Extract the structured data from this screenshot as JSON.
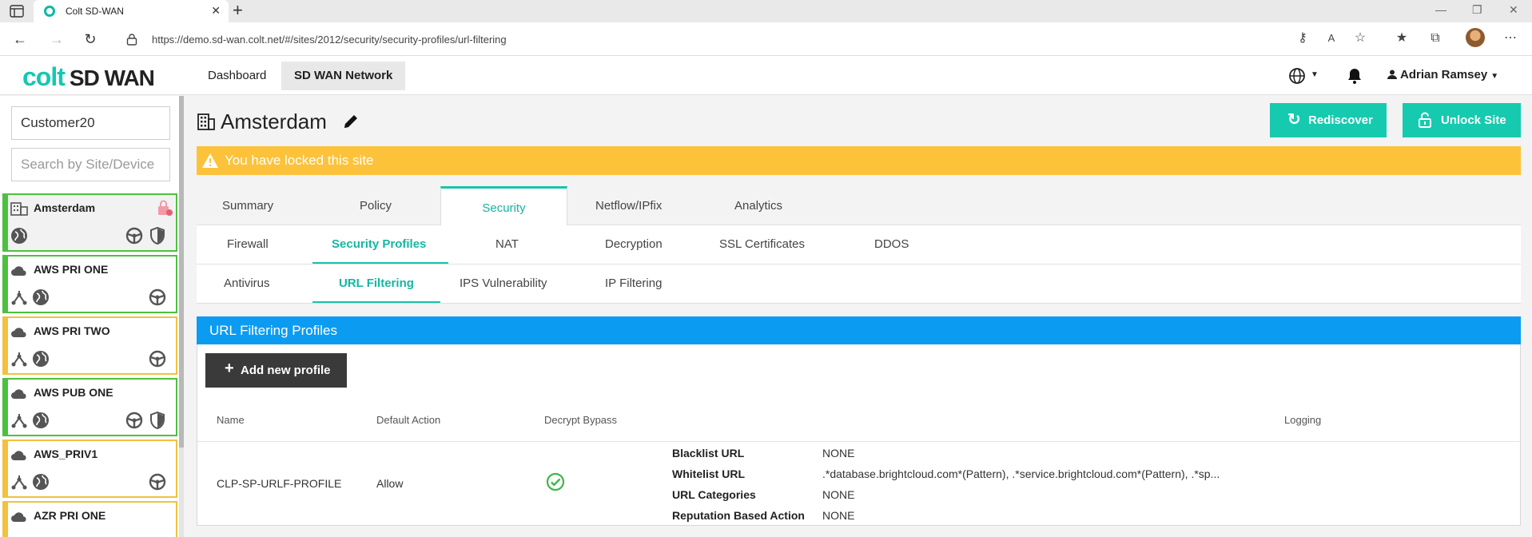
{
  "browser": {
    "tab_title": "Colt SD-WAN",
    "url": "https://demo.sd-wan.colt.net/#/sites/2012/security/security-profiles/url-filtering"
  },
  "app": {
    "logo_colt": "colt",
    "logo_sdwan": "SD WAN",
    "nav": [
      {
        "label": "Dashboard"
      },
      {
        "label": "SD WAN Network"
      }
    ],
    "user_name": "Adrian Ramsey"
  },
  "sidebar": {
    "customer": "Customer20",
    "search_placeholder": "Search by Site/Device",
    "sites": [
      {
        "name": "Amsterdam",
        "status": "green",
        "kind": "building"
      },
      {
        "name": "AWS PRI ONE",
        "status": "green",
        "kind": "cloud"
      },
      {
        "name": "AWS PRI TWO",
        "status": "yellow",
        "kind": "cloud"
      },
      {
        "name": "AWS PUB ONE",
        "status": "green",
        "kind": "cloud"
      },
      {
        "name": "AWS_PRIV1",
        "status": "yellow",
        "kind": "cloud"
      },
      {
        "name": "AZR PRI ONE",
        "status": "yellow",
        "kind": "cloud"
      }
    ]
  },
  "page": {
    "title": "Amsterdam",
    "rediscover_label": "Rediscover",
    "unlock_label": "Unlock Site",
    "alert": "You have locked this site",
    "tabs": [
      {
        "label": "Summary"
      },
      {
        "label": "Policy"
      },
      {
        "label": "Security"
      },
      {
        "label": "Netflow/IPfix"
      },
      {
        "label": "Analytics"
      }
    ],
    "security_tabs": [
      {
        "label": "Firewall"
      },
      {
        "label": "Security Profiles"
      },
      {
        "label": "NAT"
      },
      {
        "label": "Decryption"
      },
      {
        "label": "SSL Certificates"
      },
      {
        "label": "DDOS"
      }
    ],
    "profile_tabs": [
      {
        "label": "Antivirus"
      },
      {
        "label": "URL Filtering"
      },
      {
        "label": "IPS Vulnerability"
      },
      {
        "label": "IP Filtering"
      }
    ]
  },
  "panel": {
    "title": "URL Filtering Profiles",
    "add_label": "Add new profile",
    "columns": [
      "Name",
      "Default Action",
      "Decrypt Bypass",
      "Logging"
    ],
    "rows": [
      {
        "name": "CLP-SP-URLF-PROFILE",
        "default_action": "Allow",
        "details": [
          {
            "key": "Blacklist URL",
            "value": "NONE"
          },
          {
            "key": "Whitelist URL",
            "value": ".*database.brightcloud.com*(Pattern), .*service.brightcloud.com*(Pattern), .*sp..."
          },
          {
            "key": "URL Categories",
            "value": "NONE"
          },
          {
            "key": "Reputation Based Action",
            "value": "NONE"
          }
        ]
      }
    ]
  },
  "colors": {
    "accent": "#16cab0",
    "panel_header": "#0b9cf2",
    "alert": "#fcc23a",
    "status_green": "#4cc13f",
    "status_yellow": "#f3c040"
  }
}
